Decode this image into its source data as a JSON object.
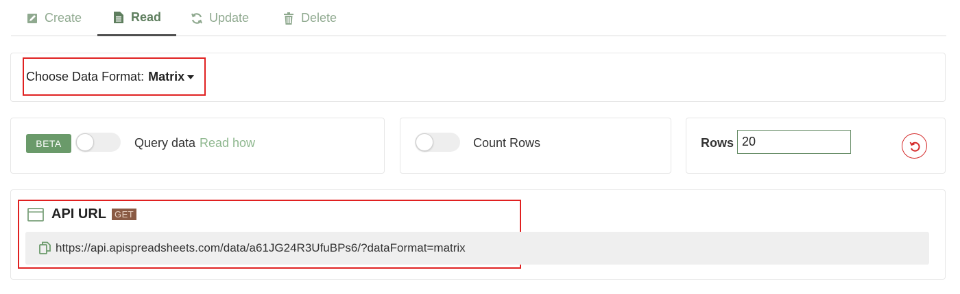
{
  "tabs": [
    {
      "label": "Create",
      "icon": "edit-icon"
    },
    {
      "label": "Read",
      "icon": "document-icon"
    },
    {
      "label": "Update",
      "icon": "refresh-arrows-icon"
    },
    {
      "label": "Delete",
      "icon": "trash-icon"
    }
  ],
  "active_tab": "Read",
  "format": {
    "label": "Choose Data Format:",
    "value": "Matrix"
  },
  "query": {
    "beta_label": "BETA",
    "label": "Query data",
    "link": "Read how",
    "enabled": false
  },
  "count": {
    "label": "Count Rows",
    "enabled": false
  },
  "rows": {
    "label": "Rows",
    "value": "20"
  },
  "api": {
    "title": "API URL",
    "method": "GET",
    "url": "https://api.apispreadsheets.com/data/a61JG24R3UfuBPs6/?dataFormat=matrix"
  },
  "colors": {
    "accent_green": "#6a9a6a",
    "tab_text": "#8fa98f",
    "highlight_red": "#e02020",
    "get_badge": "#8a5a44"
  }
}
